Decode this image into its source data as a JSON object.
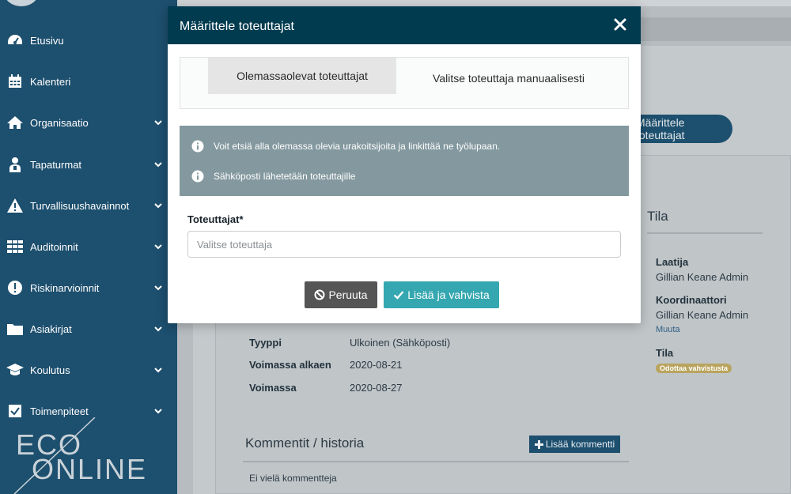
{
  "sidebar": {
    "items": [
      {
        "label": "Etusivu",
        "icon": "dashboard-icon",
        "has_submenu": false
      },
      {
        "label": "Kalenteri",
        "icon": "calendar-icon",
        "has_submenu": false
      },
      {
        "label": "Organisaatio",
        "icon": "home-icon",
        "has_submenu": true
      },
      {
        "label": "Tapaturmat",
        "icon": "injured-person-icon",
        "has_submenu": true
      },
      {
        "label": "Turvallisuushavainnot",
        "icon": "warning-icon",
        "has_submenu": true
      },
      {
        "label": "Auditoinnit",
        "icon": "grid-icon",
        "has_submenu": true
      },
      {
        "label": "Riskinarvioinnit",
        "icon": "exclamation-circle-icon",
        "has_submenu": true
      },
      {
        "label": "Asiakirjat",
        "icon": "folder-icon",
        "has_submenu": true
      },
      {
        "label": "Koulutus",
        "icon": "graduation-cap-icon",
        "has_submenu": true
      },
      {
        "label": "Toimenpiteet",
        "icon": "checkbox-icon",
        "has_submenu": true
      }
    ],
    "logo": {
      "line1": "ECO",
      "line2": "ONLINE"
    }
  },
  "background": {
    "define_button": "Määrittele toteuttajat",
    "status_heading": "Tila",
    "creator_label": "Laatija",
    "creator_value": "Gillian Keane Admin",
    "coordinator_label": "Koordinaattori",
    "coordinator_value": "Gillian Keane Admin",
    "change_link": "Muuta",
    "status_label": "Tila",
    "status_badge": "Odottaa vahvistusta",
    "details": [
      {
        "label": "Tyyppi",
        "value": "Ulkoinen (Sähköposti)"
      },
      {
        "label": "Voimassa alkaen",
        "value": "2020-08-21"
      },
      {
        "label": "Voimassa",
        "value": "2020-08-27"
      }
    ],
    "comments_heading": "Kommentit / historia",
    "add_comment_button": "Lisää kommentti",
    "no_comments": "Ei vielä kommentteja"
  },
  "modal": {
    "title": "Määrittele toteuttajat",
    "tabs": [
      {
        "label": "Olemassaolevat toteuttajat",
        "active": true
      },
      {
        "label": "Valitse toteuttaja manuaalisesti",
        "active": false
      }
    ],
    "info_lines": [
      "Voit etsiä alla olemassa olevia urakoitsijoita ja linkittää ne työlupaan.",
      "Sähköposti lähetetään toteuttajille"
    ],
    "field_label": "Toteuttajat*",
    "field_value": "",
    "field_placeholder": "Valitse toteuttaja",
    "cancel_button": "Peruuta",
    "confirm_button": "Lisää ja vahvista"
  },
  "colors": {
    "sidebar_bg": "#1d4f6e",
    "modal_header": "#003b4f",
    "info_bg": "#84999f",
    "confirm_btn": "#35a7b0",
    "cancel_btn": "#555555"
  }
}
